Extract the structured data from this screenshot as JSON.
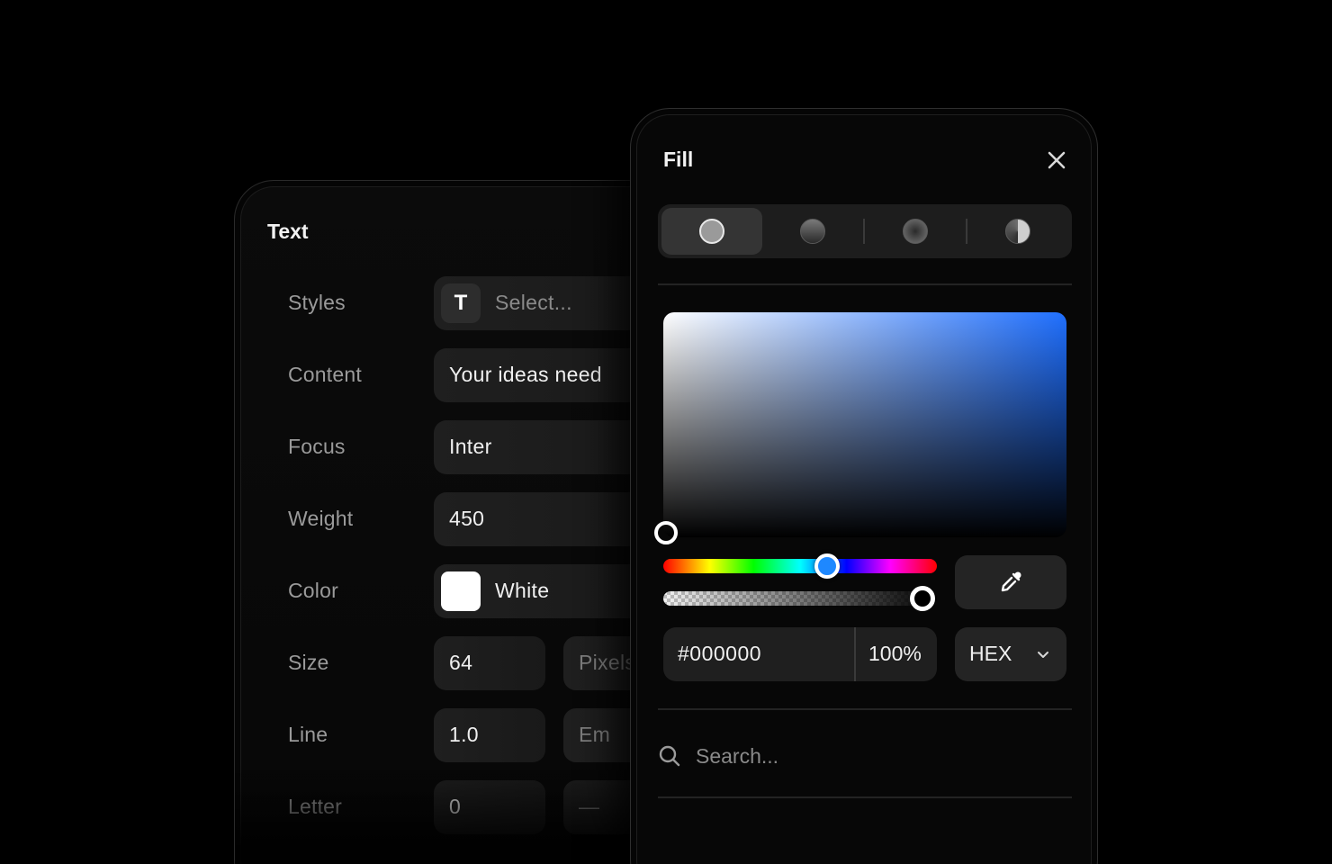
{
  "text_panel": {
    "title": "Text",
    "rows": [
      {
        "label": "Styles",
        "value": "Select...",
        "icon": "T"
      },
      {
        "label": "Content",
        "value": "Your ideas need"
      },
      {
        "label": "Focus",
        "value": "Inter"
      },
      {
        "label": "Weight",
        "value": "450"
      },
      {
        "label": "Color",
        "value": "White",
        "swatch": "#ffffff"
      },
      {
        "label": "Size",
        "value": "64",
        "unit": "Pixels"
      },
      {
        "label": "Line",
        "value": "1.0",
        "unit": "Em"
      },
      {
        "label": "Letter",
        "value": "0",
        "unit": "—"
      }
    ]
  },
  "fill_panel": {
    "title": "Fill",
    "fill_types": [
      "solid-fill-icon",
      "linear-gradient-icon",
      "radial-gradient-icon",
      "angular-gradient-icon"
    ],
    "active_fill_type": 0,
    "picker_base_color": "#1f6fff",
    "hue_position": 0.6,
    "opacity": 1.0,
    "hex_value": "#000000",
    "opacity_label": "100%",
    "format": "HEX",
    "search_placeholder": "Search..."
  }
}
